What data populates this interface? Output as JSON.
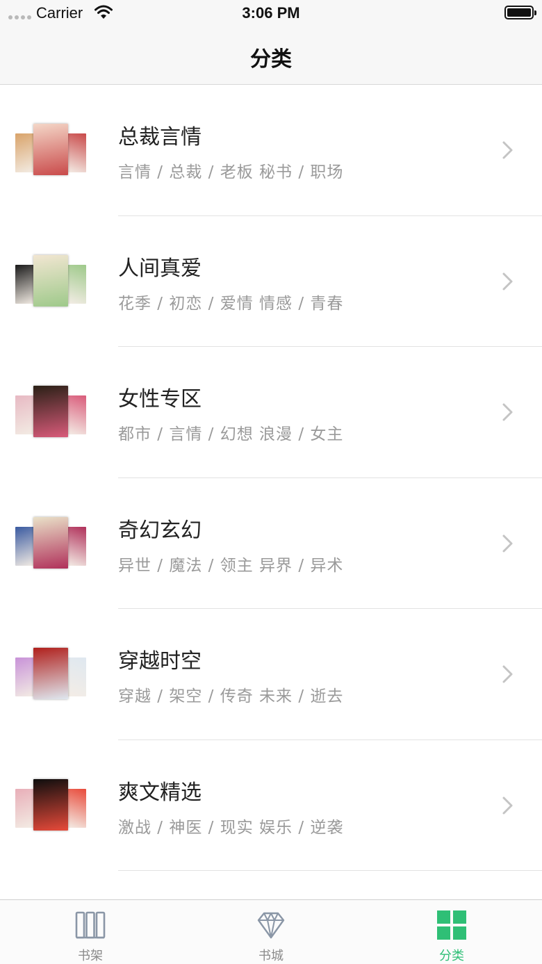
{
  "status_bar": {
    "carrier": "Carrier",
    "time": "3:06 PM"
  },
  "nav": {
    "title": "分类"
  },
  "categories": [
    {
      "title": "总裁言情",
      "tags": "言情 / 总裁 / 老板  秘书 / 职场",
      "cover_colors": [
        "#d9a36a",
        "#f4d7c8",
        "#c94a4a"
      ]
    },
    {
      "title": "人间真爱",
      "tags": "花季 / 初恋 / 爱情  情感 / 青春",
      "cover_colors": [
        "#1a1a1a",
        "#f2e6d2",
        "#9ec98a"
      ]
    },
    {
      "title": "女性专区",
      "tags": "都市 / 言情 / 幻想  浪漫 / 女主",
      "cover_colors": [
        "#e7b9c3",
        "#2a2016",
        "#d95b7a"
      ]
    },
    {
      "title": "奇幻玄幻",
      "tags": "异世 / 魔法 / 领主  异界 / 异术",
      "cover_colors": [
        "#3a5aa0",
        "#e9e1c8",
        "#b0305a"
      ]
    },
    {
      "title": "穿越时空",
      "tags": "穿越 / 架空 / 传奇  未来 / 逝去",
      "cover_colors": [
        "#c892d8",
        "#b0201c",
        "#dfe8f0"
      ]
    },
    {
      "title": "爽文精选",
      "tags": "激战 / 神医 / 现实  娱乐 / 逆袭",
      "cover_colors": [
        "#e8aeb8",
        "#0e0e0e",
        "#e84a3a"
      ]
    }
  ],
  "tabs": [
    {
      "label": "书架",
      "icon": "bookshelf-icon",
      "active": false
    },
    {
      "label": "书城",
      "icon": "diamond-icon",
      "active": false
    },
    {
      "label": "分类",
      "icon": "grid-icon",
      "active": true
    }
  ],
  "colors": {
    "accent": "#2fbf76",
    "inactive": "#8a8a8a"
  }
}
